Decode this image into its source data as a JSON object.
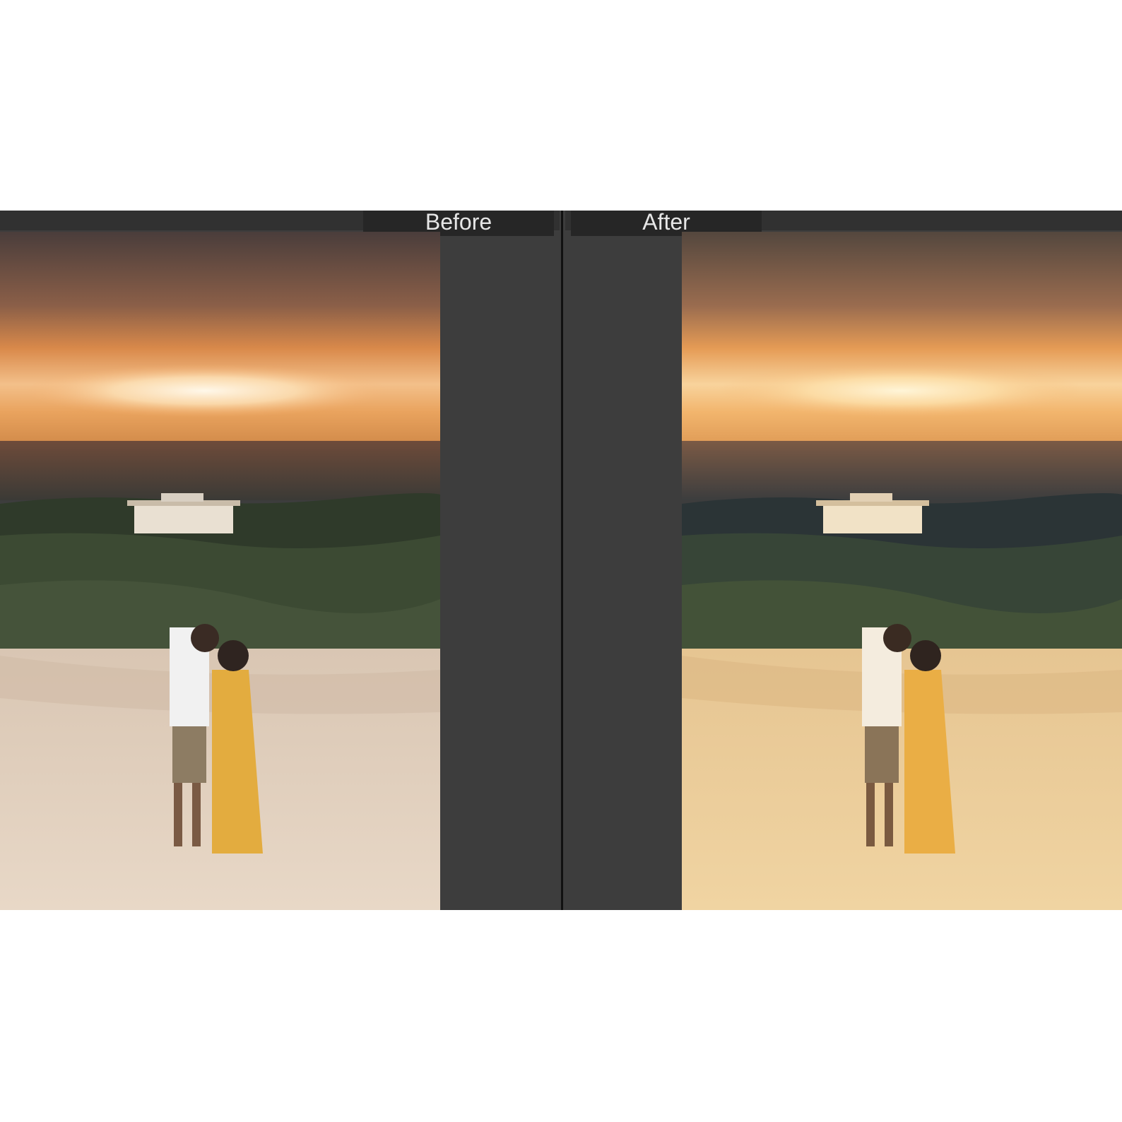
{
  "compare_view": {
    "before_label": "Before",
    "after_label": "After"
  },
  "colors": {
    "panel_bg": "#3d3d3d",
    "label_bg": "#262626",
    "label_text": "#e6e6e6"
  }
}
